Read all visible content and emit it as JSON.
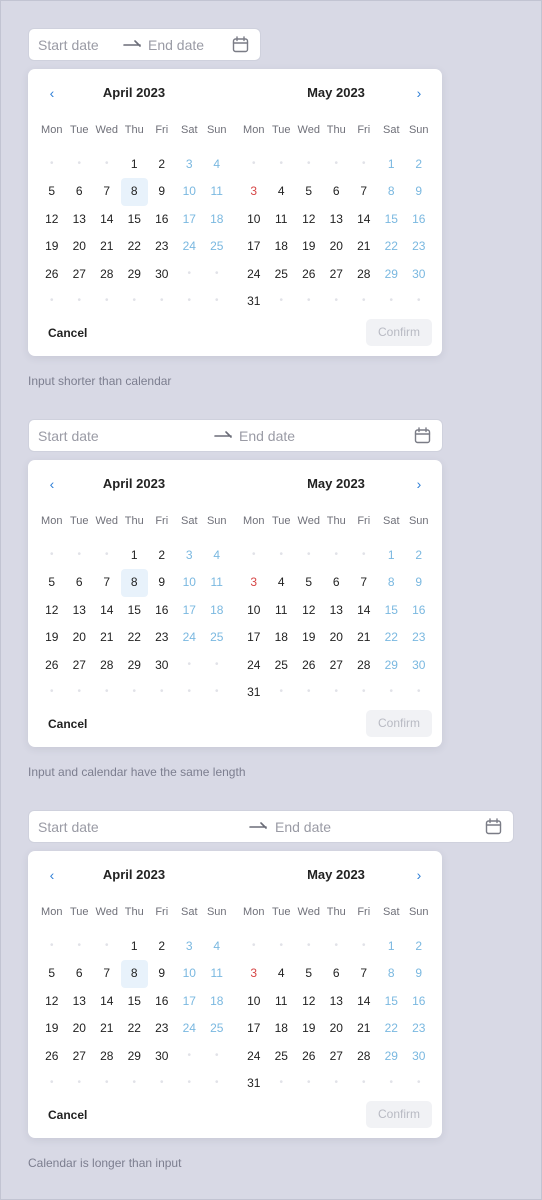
{
  "placeholders": {
    "start": "Start date",
    "end": "End date"
  },
  "buttons": {
    "cancel": "Cancel",
    "confirm": "Confirm"
  },
  "nav": {
    "prev": "‹",
    "next": "›"
  },
  "weekdays": [
    "Mon",
    "Tue",
    "Wed",
    "Thu",
    "Fri",
    "Sat",
    "Sun"
  ],
  "months": [
    {
      "title": "April 2023",
      "cells": [
        "",
        "",
        "",
        "1",
        "2",
        "3",
        "4",
        "5",
        "6",
        "7",
        "8",
        "9",
        "10",
        "11",
        "12",
        "13",
        "14",
        "15",
        "16",
        "17",
        "18",
        "19",
        "20",
        "21",
        "22",
        "23",
        "24",
        "25",
        "26",
        "27",
        "28",
        "29",
        "30",
        "",
        ""
      ],
      "selected": "8",
      "weekend_days": [
        "3",
        "4",
        "10",
        "11",
        "17",
        "18",
        "24",
        "25"
      ],
      "red_days": [],
      "rows": 6
    },
    {
      "title": "May 2023",
      "cells": [
        "",
        "",
        "",
        "",
        "",
        "1",
        "2",
        "3",
        "4",
        "5",
        "6",
        "7",
        "8",
        "9",
        "10",
        "11",
        "12",
        "13",
        "14",
        "15",
        "16",
        "17",
        "18",
        "19",
        "20",
        "21",
        "22",
        "23",
        "24",
        "25",
        "26",
        "27",
        "28",
        "29",
        "30",
        "31",
        "",
        "",
        "",
        "",
        "",
        ""
      ],
      "selected": "",
      "weekend_days": [
        "1",
        "2",
        "8",
        "9",
        "15",
        "16",
        "22",
        "23",
        "29",
        "30"
      ],
      "red_days": [
        "3"
      ],
      "rows": 6
    }
  ],
  "sections": [
    {
      "caption": "Input shorter than calendar"
    },
    {
      "caption": "Input and calendar have the same length"
    },
    {
      "caption": "Calendar is longer than input"
    }
  ],
  "colors": {
    "background": "#d8d9e5",
    "accent": "#2f7fd6",
    "weekend": "#7ab8e0",
    "holiday": "#d64545",
    "selected_bg": "#e8f2fb"
  }
}
